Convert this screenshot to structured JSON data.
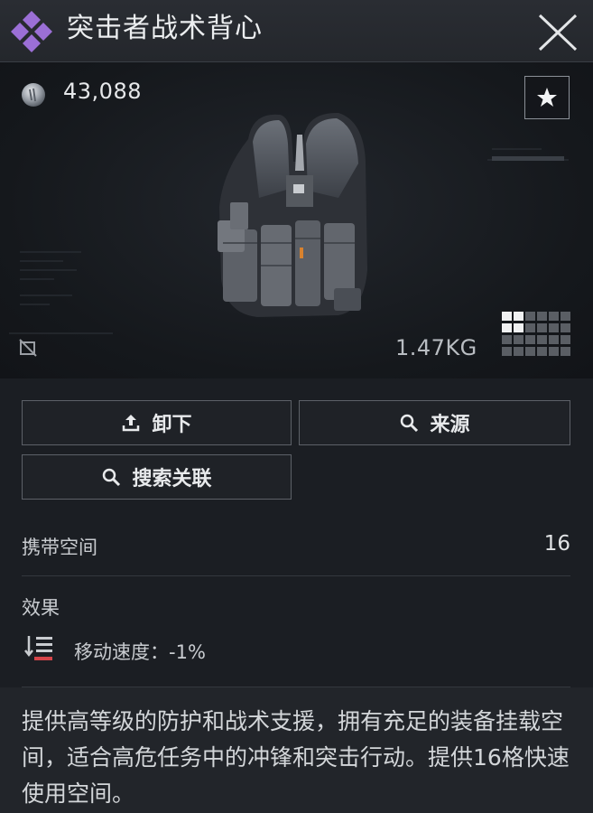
{
  "header": {
    "title": "突击者战术背心"
  },
  "item": {
    "price": "43,088",
    "weight": "1.47KG"
  },
  "actions": {
    "unequip_label": "卸下",
    "source_label": "来源",
    "related_label": "搜索关联"
  },
  "stats": {
    "capacity_label": "携带空间",
    "capacity_value": "16",
    "effect_label": "效果",
    "effect_text": "移动速度：-1%"
  },
  "description": "提供高等级的防护和战术支援，拥有充足的装备挂载空间，适合高危任务中的冲锋和突击行动。提供16格快速使用空间。",
  "colors": {
    "rarity": "#9b6fd6",
    "effect_negative": "#d6454a"
  },
  "icons": {
    "rarity": "rarity-diamond-icon",
    "close": "close-icon",
    "currency": "coin-icon",
    "favorite": "star-icon",
    "unequip": "upload-icon",
    "source": "search-icon",
    "related": "search-icon",
    "effect": "speed-down-icon",
    "size": "grid-size-icon",
    "no_image": "image-off-icon"
  }
}
